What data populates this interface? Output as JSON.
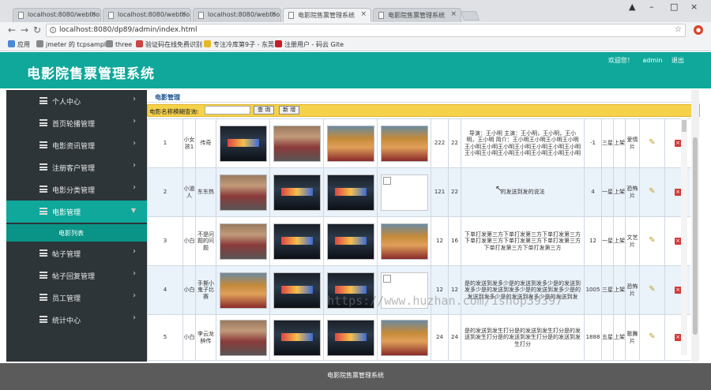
{
  "browser": {
    "tabs": [
      {
        "title": "localhost:8080/webtoo",
        "active": false
      },
      {
        "title": "localhost:8080/webtoo",
        "active": false
      },
      {
        "title": "localhost:8080/webtoo",
        "active": false
      },
      {
        "title": "电影院售票管理系统",
        "active": true
      },
      {
        "title": "电影院售票管理系统",
        "active": false
      }
    ],
    "url": "localhost:8080/dp89/admin/index.html",
    "bookmarks": [
      "应用",
      "jmeter 的 tcpsample",
      "three",
      "验证码在线免费识别",
      "专注冷库第9子 - 东莞",
      "注册用户 - 码云 Gite"
    ]
  },
  "header": {
    "title": "电影院售票管理系统",
    "welcome": "欢迎您！",
    "user": "admin",
    "logout": "退出"
  },
  "sidebar": {
    "items": [
      {
        "label": "个人中心",
        "active": false
      },
      {
        "label": "首页轮播管理",
        "active": false
      },
      {
        "label": "电影资讯管理",
        "active": false
      },
      {
        "label": "注册客户管理",
        "active": false
      },
      {
        "label": "电影分类管理",
        "active": false
      },
      {
        "label": "电影管理",
        "active": true
      },
      {
        "label": "帖子管理",
        "active": false
      },
      {
        "label": "帖子回复管理",
        "active": false
      },
      {
        "label": "员工管理",
        "active": false
      },
      {
        "label": "统计中心",
        "active": false
      }
    ],
    "sub_item": "电影列表"
  },
  "content": {
    "tab_title": "电影管理",
    "search_label": "电影名称模糊查询:",
    "search_value": "",
    "search_button": "查 询",
    "add_button": "新 增"
  },
  "rows": [
    {
      "id": "1",
      "name": "小女孩1",
      "director": "传奇",
      "cells": [
        "222",
        "22"
      ],
      "desc": "导演：王小明 主演：王小明，王小明，王小明，王小明 简介：王小明王小明王小明王小明王小明王小明王小明王小明王小明王小明王小明王小明王小明王小明王小明王小明王小明王小明",
      "price": "-1",
      "status": "三星",
      "shelf": "上架",
      "type": "爱情片",
      "img": [
        "dark",
        "person",
        "monkey",
        "monkey"
      ]
    },
    {
      "id": "2",
      "name": "小道人",
      "director": "东东热",
      "cells": [
        "121",
        "22"
      ],
      "desc": "的发送到发的说法",
      "price": "4",
      "status": "一星",
      "shelf": "上架",
      "type": "恐怖片",
      "img": [
        "person",
        "dark",
        "dark",
        "broken"
      ]
    },
    {
      "id": "3",
      "name": "小白",
      "director": "不是问题的问题",
      "cells": [
        "12",
        "16"
      ],
      "desc": "下单打发第三方下单打发第三方下单打发第三方下单打发第三方下单打发第三方下单打发第三方下单打发第三方下单打发第三方",
      "price": "12",
      "status": "一星",
      "shelf": "上架",
      "type": "文艺片",
      "img": [
        "person",
        "dark",
        "dark",
        "monkey"
      ]
    },
    {
      "id": "4",
      "name": "小白",
      "director": "手撕小鬼子比赛",
      "cells": [
        "12",
        "12"
      ],
      "desc": "是的发送到发多少是的发送到发多少是的发送到发多少是的发送到发多少是的发送到发多少是的发送到发多少是的发送到发多少是的发送到发",
      "price": "1005",
      "status": "三星",
      "shelf": "上架",
      "type": "恐怖片",
      "img": [
        "monkey",
        "dark",
        "dark",
        "broken"
      ]
    },
    {
      "id": "5",
      "name": "小白",
      "director": "李云龙醉传",
      "cells": [
        "24",
        "24"
      ],
      "desc": "是的发送到发生打分是的发送到发生打分是的发送到发生打分是的发送到发生打分是的发送到发生打分",
      "price": "1888",
      "status": "五星",
      "shelf": "上架",
      "type": "歌舞片",
      "img": [
        "person",
        "dark",
        "dark",
        "monkey"
      ]
    }
  ],
  "footer": "电影院售票管理系统",
  "watermark": "https://www.huzhan.com/1shop39397",
  "icons": {
    "edit": "pencil-icon",
    "delete": "delete-icon"
  },
  "colors": {
    "header": "#0fa89b",
    "sidebar": "#2d3538",
    "search_bar": "#f5d24a"
  }
}
